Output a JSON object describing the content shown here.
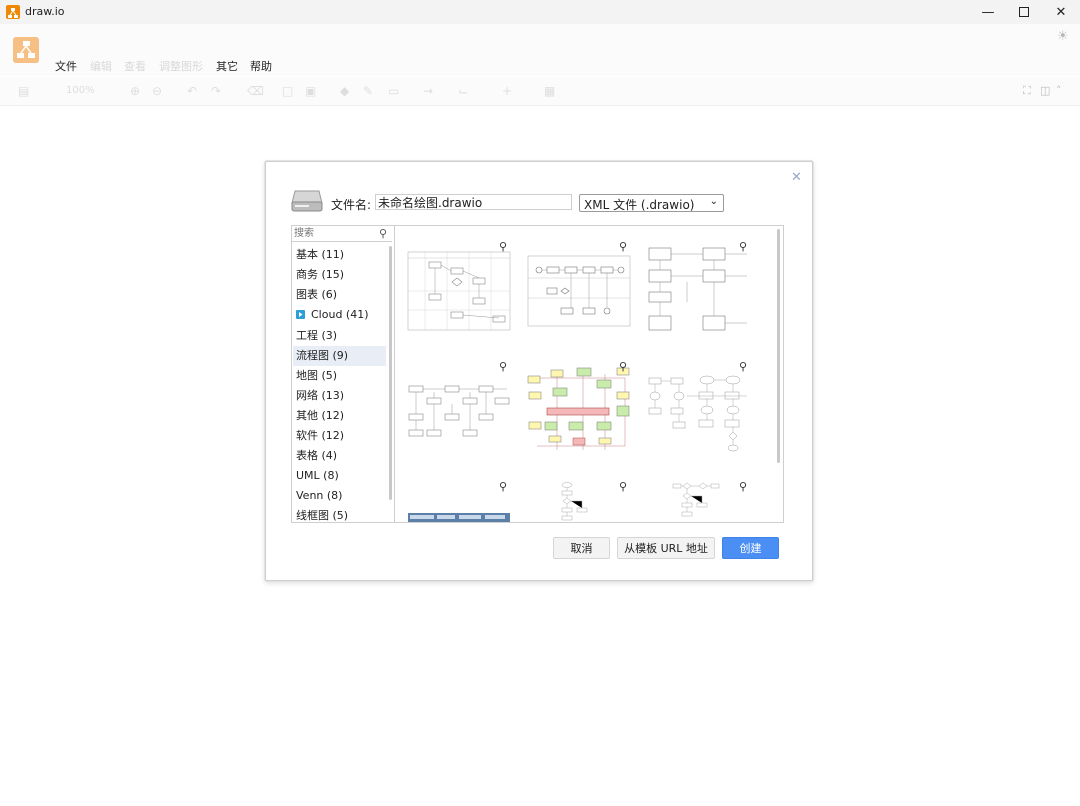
{
  "window": {
    "title": "draw.io"
  },
  "menu": {
    "file": "文件",
    "edit": "编辑",
    "view": "查看",
    "arrange": "调整图形",
    "extras": "其它",
    "help": "帮助"
  },
  "toolbar": {
    "zoom": "100%"
  },
  "dialog": {
    "filename_label": "文件名:",
    "filename_value": "未命名绘图.drawio",
    "format_selected": "XML 文件 (.drawio)",
    "search_placeholder": "搜索",
    "categories": [
      {
        "label": "基本 (11)"
      },
      {
        "label": "商务 (15)"
      },
      {
        "label": "图表 (6)"
      },
      {
        "label": "Cloud (41)"
      },
      {
        "label": "工程 (3)"
      },
      {
        "label": "流程图 (9)"
      },
      {
        "label": "地图 (5)"
      },
      {
        "label": "网络 (13)"
      },
      {
        "label": "其他 (12)"
      },
      {
        "label": "软件 (12)"
      },
      {
        "label": "表格 (4)"
      },
      {
        "label": "UML (8)"
      },
      {
        "label": "Venn (8)"
      },
      {
        "label": "线框图 (5)"
      }
    ],
    "selected_category": "流程图 (9)",
    "cancel_label": "取消",
    "url_label": "从模板 URL 地址",
    "create_label": "创建"
  },
  "colors": {
    "accent": "#4c8ff4",
    "app_orange": "#f08705",
    "selection": "#e8edf6"
  }
}
